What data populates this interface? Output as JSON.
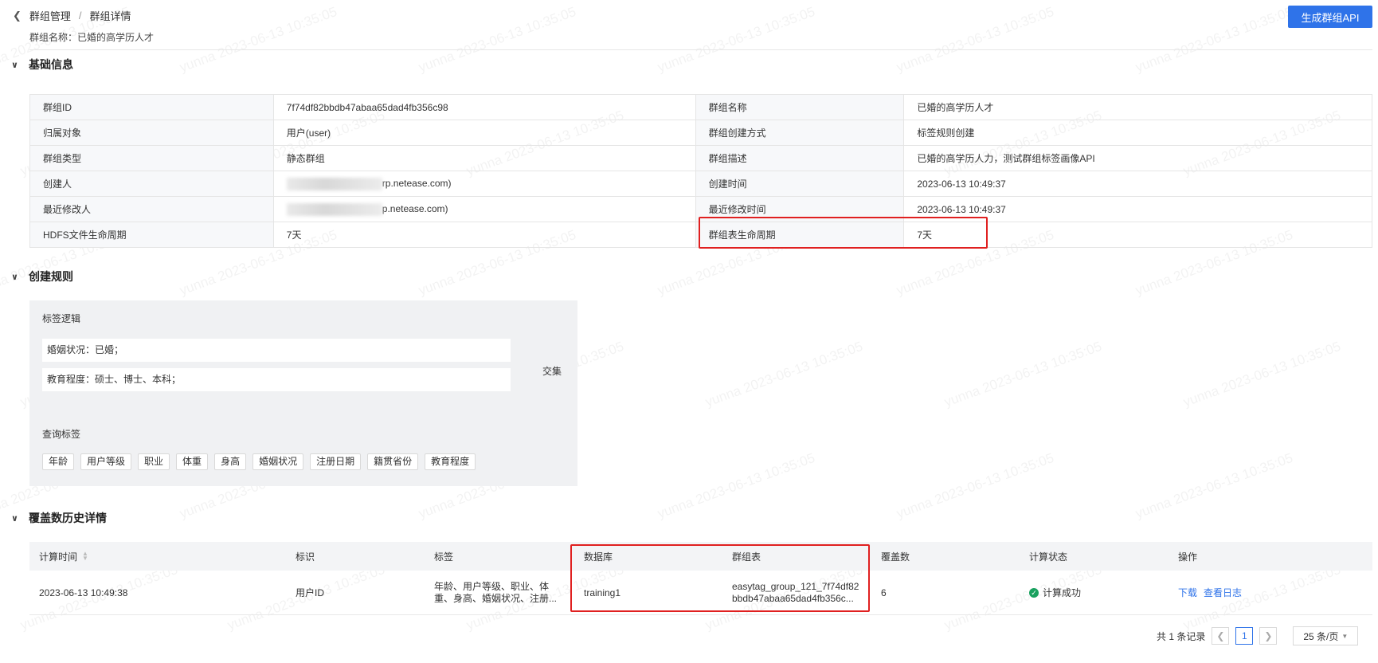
{
  "header": {
    "breadcrumb": [
      "群组管理",
      "群组详情"
    ],
    "separator": "/",
    "group_name_line": "群组名称：已婚的高学历人才",
    "api_button": "生成群组API"
  },
  "basic_info": {
    "title": "基础信息",
    "rows": [
      [
        "群组ID",
        "7f74df82bbdb47abaa65dad4fb356c98",
        "群组名称",
        "已婚的高学历人才"
      ],
      [
        "归属对象",
        "用户(user)",
        "群组创建方式",
        "标签规则创建"
      ],
      [
        "群组类型",
        "静态群组",
        "群组描述",
        "已婚的高学历人力，测试群组标签画像API"
      ],
      [
        "创建人",
        "rp.netease.com)",
        "创建时间",
        "2023-06-13 10:49:37"
      ],
      [
        "最近修改人",
        "p.netease.com)",
        "最近修改时间",
        "2023-06-13 10:49:37"
      ],
      [
        "HDFS文件生命周期",
        "7天",
        "群组表生命周期",
        "7天"
      ]
    ]
  },
  "rules": {
    "title": "创建规则",
    "logic_label": "标签逻辑",
    "conditions": [
      "婚姻状况：已婚；",
      "教育程度：硕士、博士、本科；"
    ],
    "combinator": "交集",
    "query_label": "查询标签",
    "query_tags": [
      "年龄",
      "用户等级",
      "职业",
      "体重",
      "身高",
      "婚姻状况",
      "注册日期",
      "籍贯省份",
      "教育程度"
    ]
  },
  "history": {
    "title": "覆盖数历史详情",
    "columns": [
      "计算时间",
      "标识",
      "标签",
      "数据库",
      "群组表",
      "覆盖数",
      "计算状态",
      "操作"
    ],
    "rows": [
      {
        "time": "2023-06-13 10:49:38",
        "identifier": "用户ID",
        "tags_line1": "年龄、用户等级、职业、体",
        "tags_line2": "重、身高、婚姻状况、注册...",
        "database": "training1",
        "table_line1": "easytag_group_121_7f74df82",
        "table_line2": "bbdb47abaa65dad4fb356c...",
        "coverage": "6",
        "status": "计算成功",
        "actions": [
          "下载",
          "查看日志"
        ]
      }
    ]
  },
  "pagination": {
    "total_text": "共 1 条记录",
    "current_page": "1",
    "page_size": "25 条/页"
  },
  "watermark_text": "yunna 2023-06-13 10:35:05",
  "colors": {
    "primary": "#2f73e9",
    "highlight": "#e02020",
    "success": "#19a15f"
  }
}
